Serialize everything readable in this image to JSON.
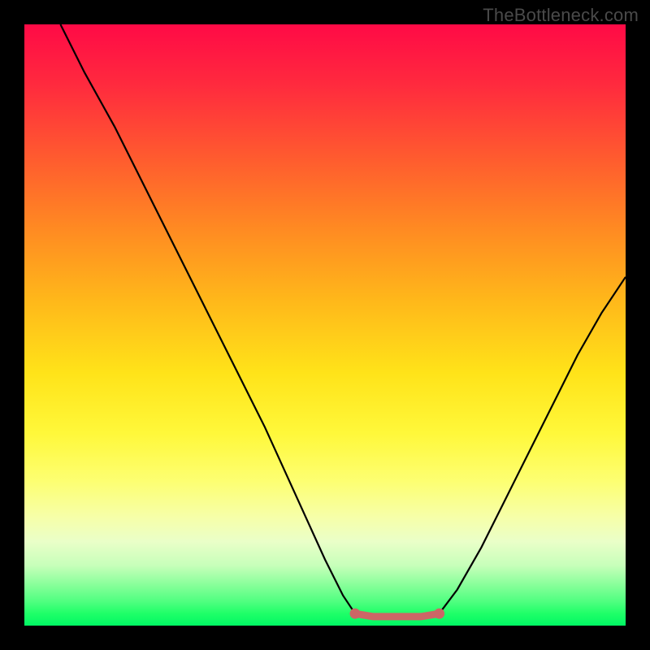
{
  "watermark": "TheBottleneck.com",
  "chart_data": {
    "type": "line",
    "title": "",
    "xlabel": "",
    "ylabel": "",
    "xlim": [
      0,
      100
    ],
    "ylim": [
      0,
      100
    ],
    "grid": false,
    "legend": false,
    "series": [
      {
        "name": "left-curve",
        "x": [
          6,
          10,
          15,
          20,
          25,
          30,
          35,
          40,
          45,
          50,
          53,
          55
        ],
        "y": [
          100,
          92,
          83,
          73,
          63,
          53,
          43,
          33,
          22,
          11,
          5,
          2
        ]
      },
      {
        "name": "flat-segment",
        "x": [
          55,
          58,
          62,
          66,
          69
        ],
        "y": [
          2,
          1.5,
          1.5,
          1.5,
          2
        ],
        "style": "salmon-thick"
      },
      {
        "name": "right-curve",
        "x": [
          69,
          72,
          76,
          80,
          84,
          88,
          92,
          96,
          100
        ],
        "y": [
          2,
          6,
          13,
          21,
          29,
          37,
          45,
          52,
          58
        ]
      }
    ],
    "endpoints": [
      {
        "x": 55,
        "y": 2
      },
      {
        "x": 69,
        "y": 2
      }
    ],
    "colors": {
      "curve": "#000000",
      "flat": "#cc6666",
      "gradient_top": "#ff0a46",
      "gradient_mid": "#ffe319",
      "gradient_bottom": "#00f763"
    }
  }
}
